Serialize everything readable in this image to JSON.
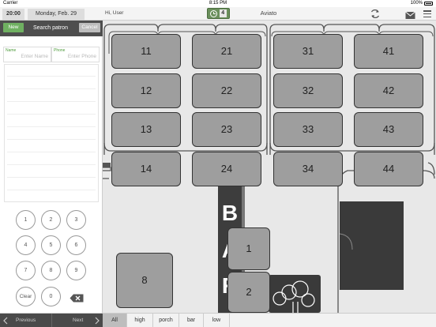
{
  "status": {
    "carrier": "Carrier",
    "time": "8:15 PM",
    "battery": "100%"
  },
  "topbar": {
    "time": "20:00",
    "date": "Monday, Feb. 29",
    "greeting": "Hi, User",
    "clock_badge": "4",
    "venue": "Aviato",
    "icons": [
      "clock-icon",
      "refresh-icon",
      "mail-icon",
      "menu-icon"
    ]
  },
  "left": {
    "new_label": "New",
    "title": "Search patron",
    "cancel_label": "Cancel",
    "name_label": "Name",
    "name_placeholder": "Enter Name",
    "phone_label": "Phone",
    "phone_placeholder": "Enter Phone",
    "keys": [
      "1",
      "2",
      "3",
      "4",
      "5",
      "6",
      "7",
      "8",
      "9",
      "Clear",
      "0"
    ]
  },
  "bottom": {
    "prev_label": "Previous",
    "next_label": "Next",
    "filters": [
      "All",
      "high",
      "porch",
      "bar",
      "low"
    ],
    "active_filter": "All"
  },
  "floor": {
    "tables": [
      "11",
      "21",
      "31",
      "41",
      "12",
      "22",
      "32",
      "42",
      "13",
      "23",
      "33",
      "43",
      "14",
      "24",
      "34",
      "44",
      "1",
      "2",
      "8"
    ],
    "bar_letters": "BAR"
  },
  "colors": {
    "accent": "#6fb061",
    "header": "#4e4e4e",
    "table": "#9e9e9e",
    "floor": "#e8e8e8"
  }
}
